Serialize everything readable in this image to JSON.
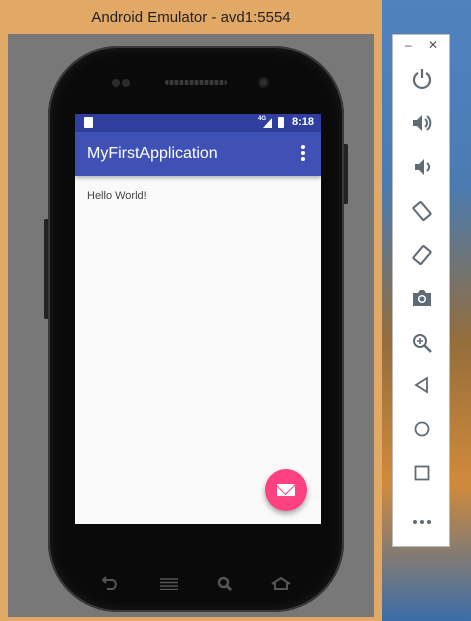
{
  "window": {
    "title": "Android Emulator - avd1:5554"
  },
  "status_bar": {
    "network": "4G",
    "time": "8:18"
  },
  "app": {
    "title": "MyFirstApplication",
    "content_text": "Hello World!",
    "appbar_color": "#3f51b5",
    "statusbar_color": "#303f9f",
    "fab_color": "#ff4081"
  },
  "nav_keys": [
    {
      "icon": "back-icon"
    },
    {
      "icon": "menu-icon"
    },
    {
      "icon": "search-icon"
    },
    {
      "icon": "home-icon"
    }
  ],
  "sidebar": {
    "minimize": "–",
    "close": "✕",
    "tools": [
      {
        "icon": "power-icon"
      },
      {
        "icon": "volume-up-icon"
      },
      {
        "icon": "volume-down-icon"
      },
      {
        "icon": "rotate-left-icon"
      },
      {
        "icon": "rotate-right-icon"
      },
      {
        "icon": "camera-icon"
      },
      {
        "icon": "zoom-icon"
      },
      {
        "icon": "back-triangle-icon"
      },
      {
        "icon": "home-circle-icon"
      },
      {
        "icon": "overview-square-icon"
      },
      {
        "icon": "more-icon"
      }
    ]
  }
}
